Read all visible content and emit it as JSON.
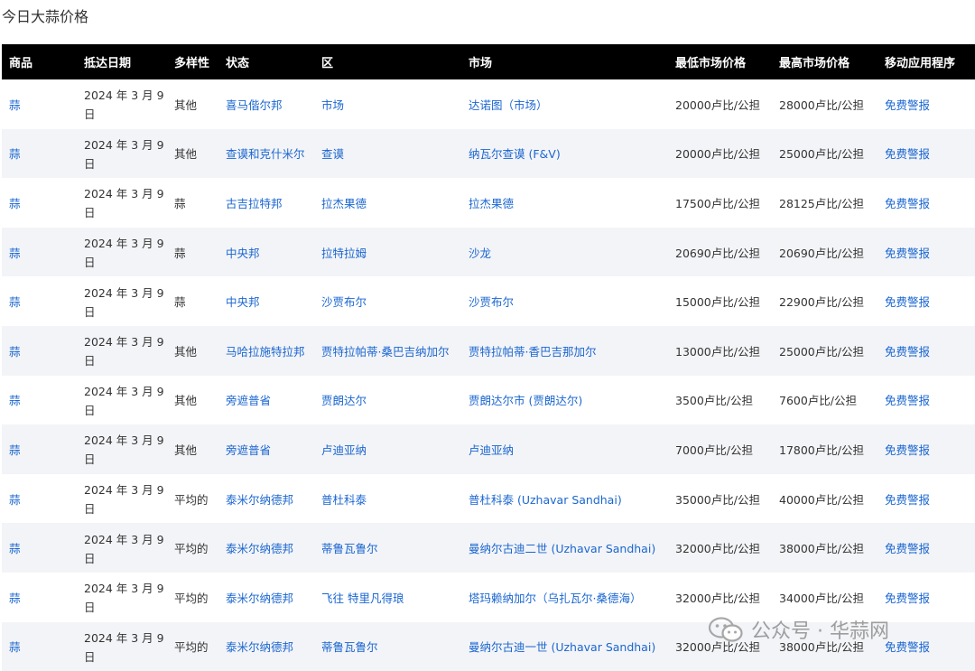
{
  "title": "今日大蒜价格",
  "columns": [
    "商品",
    "抵达日期",
    "多样性",
    "状态",
    "区",
    "市场",
    "最低市场价格",
    "最高市场价格",
    "移动应用程序"
  ],
  "rows": [
    {
      "commodity": "蒜",
      "date": "2024 年 3 月 9 日",
      "variety": "其他",
      "state": "喜马偕尔邦",
      "district": "市场",
      "market": "达诺图（市场）",
      "min": "20000卢比/公担",
      "max": "28000卢比/公担",
      "app": "免费警报"
    },
    {
      "commodity": "蒜",
      "date": "2024 年 3 月 9 日",
      "variety": "其他",
      "state": "查谟和克什米尔",
      "district": "查谟",
      "market": "纳瓦尔查谟 (F&V)",
      "min": "20000卢比/公担",
      "max": "25000卢比/公担",
      "app": "免费警报"
    },
    {
      "commodity": "蒜",
      "date": "2024 年 3 月 9 日",
      "variety": "蒜",
      "state": "古吉拉特邦",
      "district": "拉杰果德",
      "market": "拉杰果德",
      "min": "17500卢比/公担",
      "max": "28125卢比/公担",
      "app": "免费警报"
    },
    {
      "commodity": "蒜",
      "date": "2024 年 3 月 9 日",
      "variety": "蒜",
      "state": "中央邦",
      "district": "拉特拉姆",
      "market": "沙龙",
      "min": "20690卢比/公担",
      "max": "20690卢比/公担",
      "app": "免费警报"
    },
    {
      "commodity": "蒜",
      "date": "2024 年 3 月 9 日",
      "variety": "蒜",
      "state": "中央邦",
      "district": "沙贾布尔",
      "market": "沙贾布尔",
      "min": "15000卢比/公担",
      "max": "22900卢比/公担",
      "app": "免费警报"
    },
    {
      "commodity": "蒜",
      "date": "2024 年 3 月 9 日",
      "variety": "其他",
      "state": "马哈拉施特拉邦",
      "district": "贾特拉帕蒂·桑巴吉纳加尔",
      "market": "贾特拉帕蒂·香巴吉那加尔",
      "min": "13000卢比/公担",
      "max": "25000卢比/公担",
      "app": "免费警报"
    },
    {
      "commodity": "蒜",
      "date": "2024 年 3 月 9 日",
      "variety": "其他",
      "state": "旁遮普省",
      "district": "贾朗达尔",
      "market": "贾朗达尔市 (贾朗达尔)",
      "min": "3500卢比/公担",
      "max": "7600卢比/公担",
      "app": "免费警报"
    },
    {
      "commodity": "蒜",
      "date": "2024 年 3 月 9 日",
      "variety": "其他",
      "state": "旁遮普省",
      "district": "卢迪亚纳",
      "market": "卢迪亚纳",
      "min": "7000卢比/公担",
      "max": "17800卢比/公担",
      "app": "免费警报"
    },
    {
      "commodity": "蒜",
      "date": "2024 年 3 月 9 日",
      "variety": "平均的",
      "state": "泰米尔纳德邦",
      "district": "普杜科泰",
      "market": "普杜科泰 (Uzhavar Sandhai)",
      "min": "35000卢比/公担",
      "max": "40000卢比/公担",
      "app": "免费警报"
    },
    {
      "commodity": "蒜",
      "date": "2024 年 3 月 9 日",
      "variety": "平均的",
      "state": "泰米尔纳德邦",
      "district": "蒂鲁瓦鲁尔",
      "market": "曼纳尔古迪二世 (Uzhavar Sandhai)",
      "min": "32000卢比/公担",
      "max": "38000卢比/公担",
      "app": "免费警报"
    },
    {
      "commodity": "蒜",
      "date": "2024 年 3 月 9 日",
      "variety": "平均的",
      "state": "泰米尔纳德邦",
      "district": "飞往 特里凡得琅",
      "market": "塔玛赖纳加尔（乌扎瓦尔·桑德海）",
      "min": "32000卢比/公担",
      "max": "34000卢比/公担",
      "app": "免费警报"
    },
    {
      "commodity": "蒜",
      "date": "2024 年 3 月 9 日",
      "variety": "平均的",
      "state": "泰米尔纳德邦",
      "district": "蒂鲁瓦鲁尔",
      "market": "曼纳尔古迪一世 (Uzhavar Sandhai)",
      "min": "32000卢比/公担",
      "max": "38000卢比/公担",
      "app": "免费警报"
    }
  ],
  "watermark": {
    "text": "公众号 · 华蒜网",
    "icon": "wechat-icon"
  }
}
